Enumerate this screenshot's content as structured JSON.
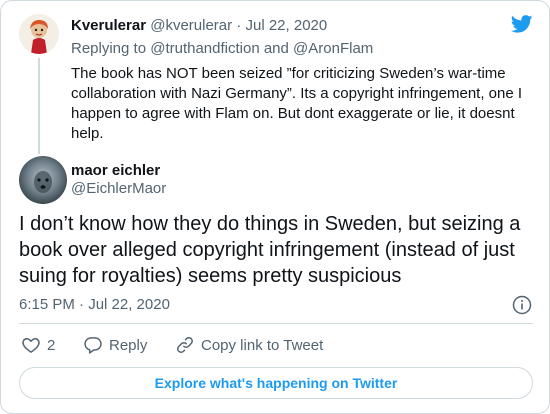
{
  "accent_color": "#1d9bf0",
  "parent_tweet": {
    "avatar_icon": "cartoon-character-avatar",
    "name": "Kverulerar",
    "handle": "@kverulerar",
    "separator": "·",
    "date": "Jul 22, 2020",
    "replying_prefix": "Replying to",
    "mention_1": "@truthandfiction",
    "mention_joiner": "and",
    "mention_2": "@AronFlam",
    "text": "The book has NOT been seized ”for criticizing Sweden’s war-time collaboration with Nazi Germany”. Its a copyright infringement, one I happen to agree with Flam on. But dont exaggerate or lie, it doesnt help."
  },
  "main_tweet": {
    "avatar_icon": "dark-photo-avatar",
    "name": "maor eichler",
    "handle": "@EichlerMaor",
    "text": "I don’t know how they do things in Sweden, but seizing a book over alleged copyright infringement (instead of just suing for royalties) seems pretty suspicious",
    "timestamp": "6:15 PM · Jul 22, 2020"
  },
  "actions": {
    "like_count": "2",
    "reply_label": "Reply",
    "copy_link_label": "Copy link to Tweet"
  },
  "explore_label": "Explore what's happening on Twitter"
}
